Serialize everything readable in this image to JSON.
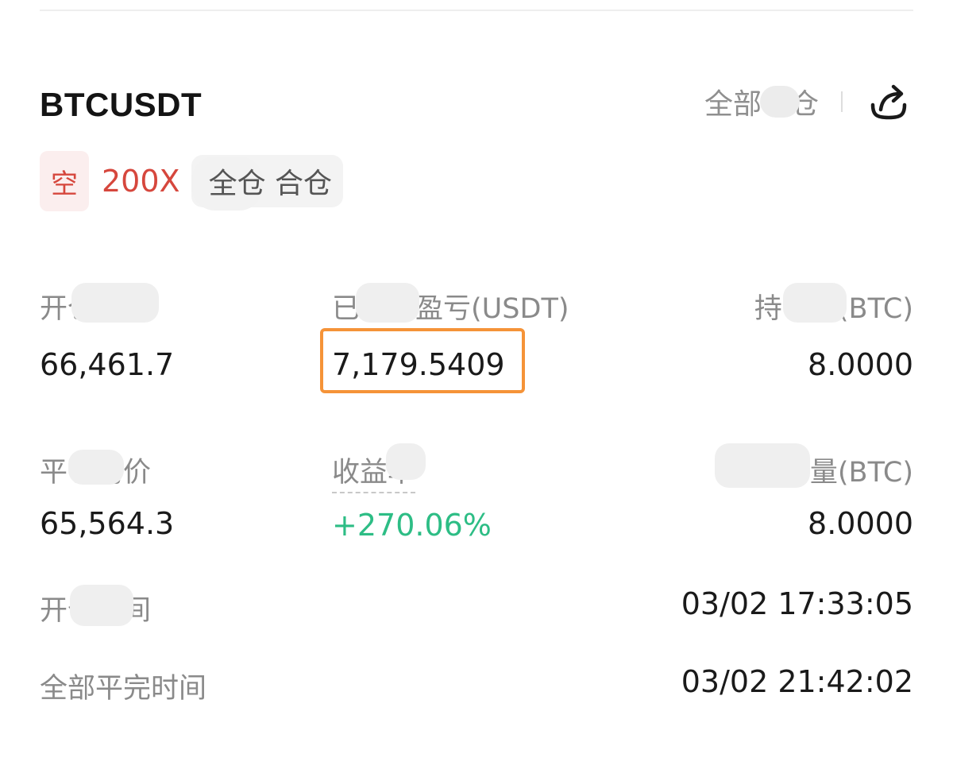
{
  "header": {
    "symbol": "BTCUSDT",
    "history_link": "全部平仓",
    "share_icon": "share-icon"
  },
  "tags": {
    "side": "空",
    "leverage": "200X",
    "margin_mode": "全仓 合仓"
  },
  "stats": {
    "open_avg_price_label": "开仓均价",
    "open_avg_price_value": "66,461.7",
    "realized_pnl_label": "已实现盈亏(USDT)",
    "realized_pnl_value": "7,179.5409",
    "position_size_label": "持仓量(BTC)",
    "position_size_value": "8.0000",
    "close_avg_price_label": "平仓均价",
    "close_avg_price_value": "65,564.3",
    "yield_label": "收益率",
    "yield_value": "+270.06%",
    "closed_size_label": "平仓量(BTC)",
    "closed_size_value": "8.0000",
    "open_time_label": "开仓时间",
    "open_time_value": "03/02 17:33:05",
    "close_time_label": "全部平完时间",
    "close_time_value": "03/02 21:42:02"
  },
  "colors": {
    "short_red": "#d6473d",
    "profit_green": "#2dbd85",
    "highlight_orange": "#f59338"
  }
}
